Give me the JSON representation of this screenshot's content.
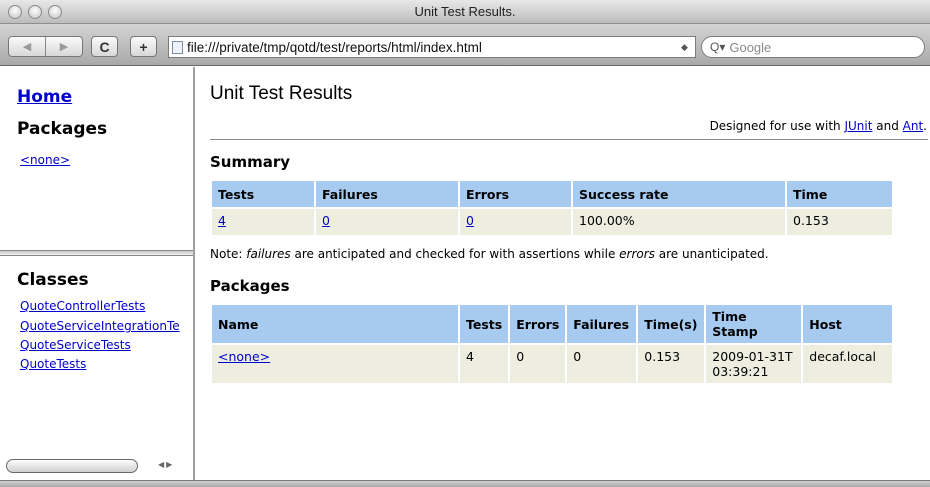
{
  "window": {
    "title": "Unit Test Results.",
    "url": "file:///private/tmp/qotd/test/reports/html/index.html",
    "search_placeholder": "Google",
    "reload_glyph": "C",
    "add_glyph": "+"
  },
  "sidebar": {
    "home_label": "Home",
    "packages_heading": "Packages",
    "packages": [
      "<none>"
    ],
    "classes_heading": "Classes",
    "classes": [
      "QuoteControllerTests",
      "QuoteServiceIntegrationTe",
      "QuoteServiceTests",
      "QuoteTests"
    ]
  },
  "main": {
    "title": "Unit Test Results",
    "designed_prefix": "Designed for use with ",
    "designed_junit": "JUnit",
    "designed_and": " and ",
    "designed_ant": "Ant",
    "designed_suffix": ".",
    "summary_heading": "Summary",
    "summary_columns": [
      "Tests",
      "Failures",
      "Errors",
      "Success rate",
      "Time"
    ],
    "summary_row": [
      "4",
      "0",
      "0",
      "100.00%",
      "0.153"
    ],
    "note_prefix": "Note: ",
    "note_failures": "failures",
    "note_middle": " are anticipated and checked for with assertions while ",
    "note_errors": "errors",
    "note_suffix": " are unanticipated.",
    "packages_heading": "Packages",
    "packages_columns": [
      "Name",
      "Tests",
      "Errors",
      "Failures",
      "Time(s)",
      "Time Stamp",
      "Host"
    ],
    "packages_row": [
      "<none>",
      "4",
      "0",
      "0",
      "0.153",
      "2009-01-31T03:39:21",
      "decaf.local"
    ]
  },
  "colors": {
    "header_cell": "#a6caf0",
    "body_cell": "#eeeee0",
    "link": "#0000cc"
  },
  "icons": {
    "back": "back-arrow-icon",
    "forward": "forward-arrow-icon",
    "reload": "reload-icon",
    "add": "add-bookmark-icon",
    "search": "search-icon"
  }
}
